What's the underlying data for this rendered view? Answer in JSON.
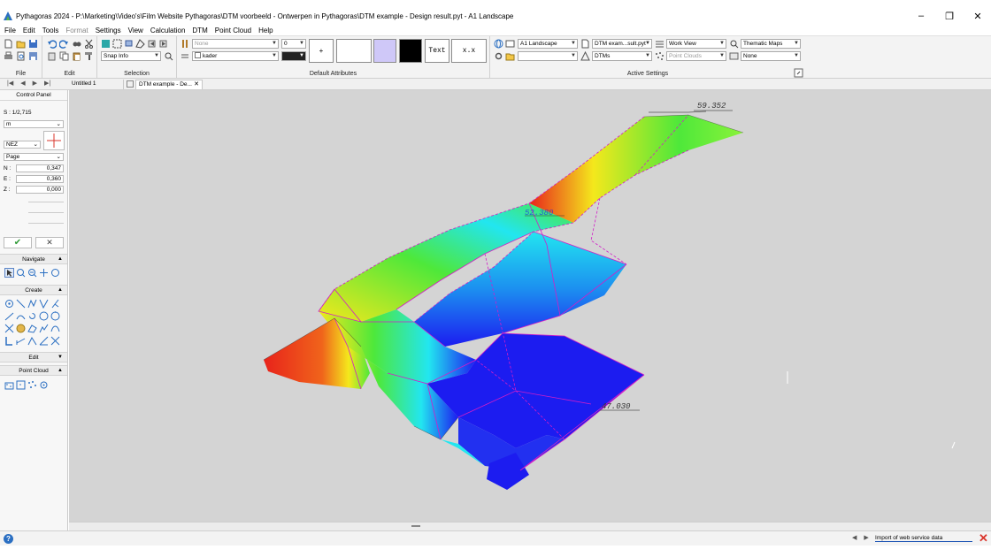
{
  "window": {
    "title": "Pythagoras 2024 - P:\\Marketing\\Video's\\Film Website Pythagoras\\DTM voorbeeld - Ontwerpen in Pythagoras\\DTM example - Design result.pyt - A1 Landscape",
    "minimize": "–",
    "restore": "❐",
    "close": "✕"
  },
  "menu": [
    "File",
    "Edit",
    "Tools",
    "Format",
    "Settings",
    "View",
    "Calculation",
    "DTM",
    "Point Cloud",
    "Help"
  ],
  "ribbon": {
    "file_label": "File",
    "edit_label": "Edit",
    "selection_label": "Selection",
    "snap_value": "Snap Info",
    "attributes_label": "Default Attributes",
    "layer_value": "None",
    "linewidth_value": "0",
    "layer2_value": "kader",
    "point_symbol": "+",
    "text_btn": "Text",
    "dim_btn": "x.x",
    "active_label": "Active Settings",
    "layout_value": "A1 Landscape",
    "dtm_file_value": "DTM exam...sult.pyt",
    "view_value": "Work View",
    "thematic_value": "Thematic Maps",
    "dtms_value": "DTMs",
    "pointclouds_value": "Point Clouds",
    "none_value": "None",
    "colors": {
      "lavender": "#cfc8f8",
      "black": "#000000",
      "dark": "#222222"
    }
  },
  "doctabs": {
    "nav": [
      "|◀",
      "◀",
      "▶",
      "▶|"
    ],
    "tab1": "Untitled 1",
    "tab2": "DTM example - De...",
    "close": "✕"
  },
  "panel": {
    "title": "Control Panel",
    "scale": "S : 1/2,715",
    "unit": "m",
    "coord_system": "NEZ",
    "page": "Page",
    "n_label": "N :",
    "n_value": "0,347",
    "e_label": "E :",
    "e_value": "0,360",
    "z_label": "Z :",
    "z_value": "0,000",
    "navigate": "Navigate",
    "create": "Create",
    "edit": "Edit",
    "point_cloud": "Point Cloud"
  },
  "viewport": {
    "labels": [
      "59.352",
      "52.380",
      "47.030"
    ],
    "colors": {
      "red": "#e8231b",
      "yellow": "#f4e81c",
      "green": "#4ee83a",
      "cyan": "#22e6f0",
      "blue": "#1c1cf0",
      "magenta": "#d21ec8"
    }
  },
  "status": {
    "help": "?",
    "nav": [
      "◀",
      "▶"
    ],
    "link": "Import of web service data",
    "close": "✕"
  }
}
